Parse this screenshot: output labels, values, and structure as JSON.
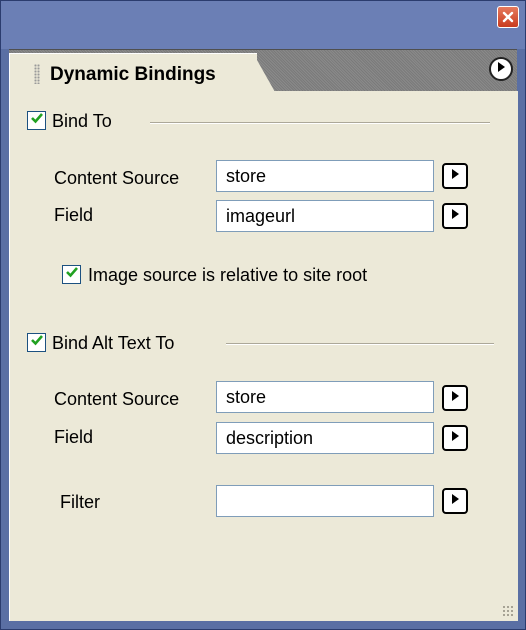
{
  "panel": {
    "tab_title": "Dynamic Bindings"
  },
  "bind_to": {
    "label": "Bind To",
    "checked": true,
    "content_source_label": "Content Source",
    "content_source_value": "store",
    "field_label": "Field",
    "field_value": "imageurl",
    "relative_label": "Image source is relative to site root",
    "relative_checked": true
  },
  "bind_alt": {
    "label": "Bind Alt Text To",
    "checked": true,
    "content_source_label": "Content Source",
    "content_source_value": "store",
    "field_label": "Field",
    "field_value": "description",
    "filter_label": "Filter",
    "filter_value": ""
  },
  "icons": {
    "close": "close-icon",
    "menu": "panel-menu-icon",
    "arrow": "play-arrow-icon",
    "check": "checkmark-icon"
  },
  "colors": {
    "panel_blue": "#5a6fa4",
    "content_bg": "#ece9d8",
    "check_green": "#21a121",
    "close_red": "#c93b1e"
  }
}
